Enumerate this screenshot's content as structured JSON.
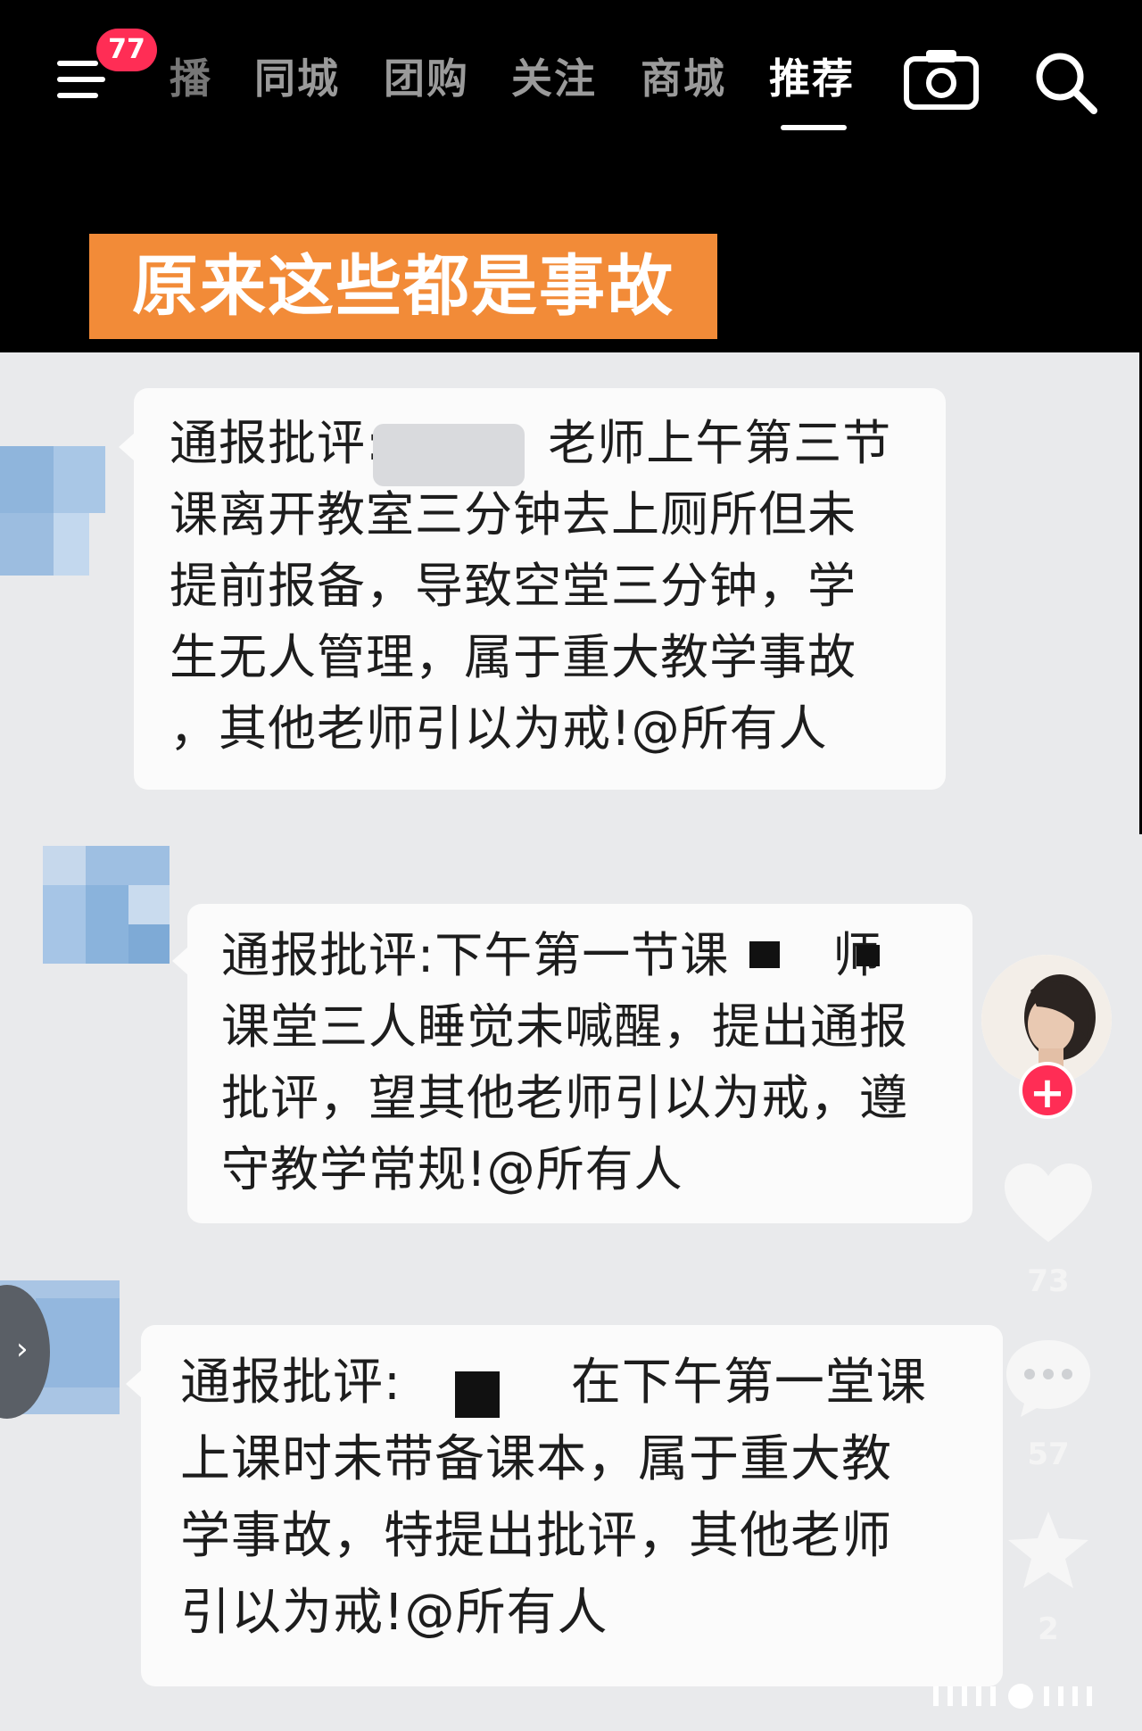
{
  "nav": {
    "badge_count": "77",
    "tabs": [
      {
        "label": "播",
        "active": false
      },
      {
        "label": "同城",
        "active": false
      },
      {
        "label": "团购",
        "active": false
      },
      {
        "label": "关注",
        "active": false
      },
      {
        "label": "商城",
        "active": false
      },
      {
        "label": "推荐",
        "active": true
      }
    ],
    "icons": [
      "menu-icon",
      "camera-icon",
      "search-icon"
    ]
  },
  "video": {
    "caption": "原来这些都是事故"
  },
  "messages": [
    {
      "lines": [
        "通报批评:",
        "老师上午第三节",
        "课离开教室三分钟去上厕所但未",
        "提前报备，导致空堂三分钟，学",
        "生无人管理，属于重大教学事故",
        "，其他老师引以为戒!@所有人"
      ]
    },
    {
      "lines": [
        "通报批评:下午第一节课",
        "师",
        "课堂三人睡觉未喊醒，提出通报",
        "批评，望其他老师引以为戒，遵",
        "守教学常规!@所有人"
      ]
    },
    {
      "lines": [
        "通报批评:",
        "在下午第一堂课",
        "上课时未带备课本，属于重大教",
        "学事故，特提出批评，其他老师",
        "引以为戒!@所有人"
      ]
    }
  ],
  "sidebar": {
    "like_count": "73",
    "comment_count": "57",
    "favorite_count": "2"
  },
  "colors": {
    "caption_bg": "#f28b38",
    "badge_bg": "#ff2d55",
    "follow_bg": "#ff2d55",
    "screen_bg": "#e9eaec"
  }
}
